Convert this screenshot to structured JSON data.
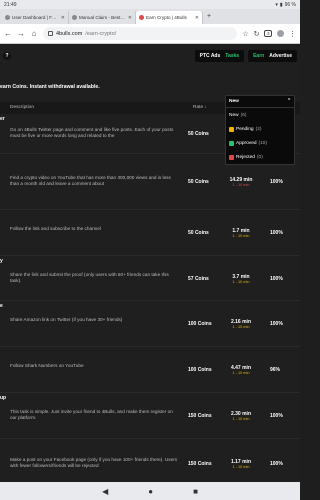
{
  "status": {
    "time": "21:49",
    "battery": "96 %"
  },
  "tabs": [
    {
      "title": "User Dashboard | FaucetPay",
      "active": false
    },
    {
      "title": "Manual Claim - Best-shop F",
      "active": false
    },
    {
      "title": "Earn Crypto | 4Bulls",
      "active": true
    }
  ],
  "address": {
    "domain": "4bulls.com",
    "path": "/earn-crypto/",
    "tab_count": "3"
  },
  "header": {
    "left_icon": "?",
    "ptc_ads": "PTC Ads",
    "tasks": "Tasks",
    "earn": "Earn",
    "advertise": "Advertise"
  },
  "banner": "earn Coins. Instant withdrawal available.",
  "table_head": {
    "description": "Description",
    "rate": "Rate ↓"
  },
  "rows": [
    {
      "cut": "er",
      "desc": "Go on 4Bulls Twitter page and comment and like five posts. Each of your posts must be five or more words long and related to the",
      "reward": "50 Coins",
      "time": "",
      "sub": "",
      "pct": ""
    },
    {
      "cut": "",
      "desc": "Find a crypto video on YouTube that has more than 300,000 views and is less than a month old and leave a comment about",
      "reward": "50 Coins",
      "time": "14.29 min",
      "sub": "1 - 10 min",
      "pct": "100%"
    },
    {
      "cut": "",
      "desc": "Follow the link and subscribe to the channel",
      "reward": "50 Coins",
      "time": "1.7 min",
      "sub": "1 - 10 min",
      "pct": "100%"
    },
    {
      "cut": "y",
      "desc": "Share the link and submit the proof (only users with 50+ friends can take this task).",
      "reward": "57 Coins",
      "time": "3.7 min",
      "sub": "1 - 10 min",
      "pct": "100%"
    },
    {
      "cut": "e",
      "desc": "Share Amazon link on Twitter (if you have 30+ friends)",
      "reward": "100 Coins",
      "time": "2.16 min",
      "sub": "1 - 10 min",
      "pct": "100%"
    },
    {
      "cut": "",
      "desc": "Follow Shark Numbers on YouTube",
      "reward": "100 Coins",
      "time": "4.47 min",
      "sub": "1 - 10 min",
      "pct": "96%"
    },
    {
      "cut": "up",
      "desc": "This task is simple. Just invite your friend to 4Bulls, and make them register on our platform.",
      "reward": "150 Coins",
      "time": "2.30 min",
      "sub": "1 - 10 min",
      "pct": "100%"
    },
    {
      "cut": "",
      "desc": "Make a post on your Facebook page (only if you have 100+ friends there). Users with fewer followers/friends will be rejected",
      "reward": "150 Coins",
      "time": "1.17 min",
      "sub": "1 - 10 min",
      "pct": "100%"
    }
  ],
  "dropdown": {
    "selected": "New",
    "items": [
      {
        "label": "New",
        "count": "(6)",
        "color": ""
      },
      {
        "label": "Pending",
        "count": "(2)",
        "color": "#f0b400"
      },
      {
        "label": "Approved",
        "count": "(10)",
        "color": "#27c36b"
      },
      {
        "label": "Rejected",
        "count": "(0)",
        "color": "#e04848"
      }
    ]
  },
  "colors": {
    "accent": "#27c36b",
    "warning": "#f0b400",
    "danger": "#e04848"
  }
}
